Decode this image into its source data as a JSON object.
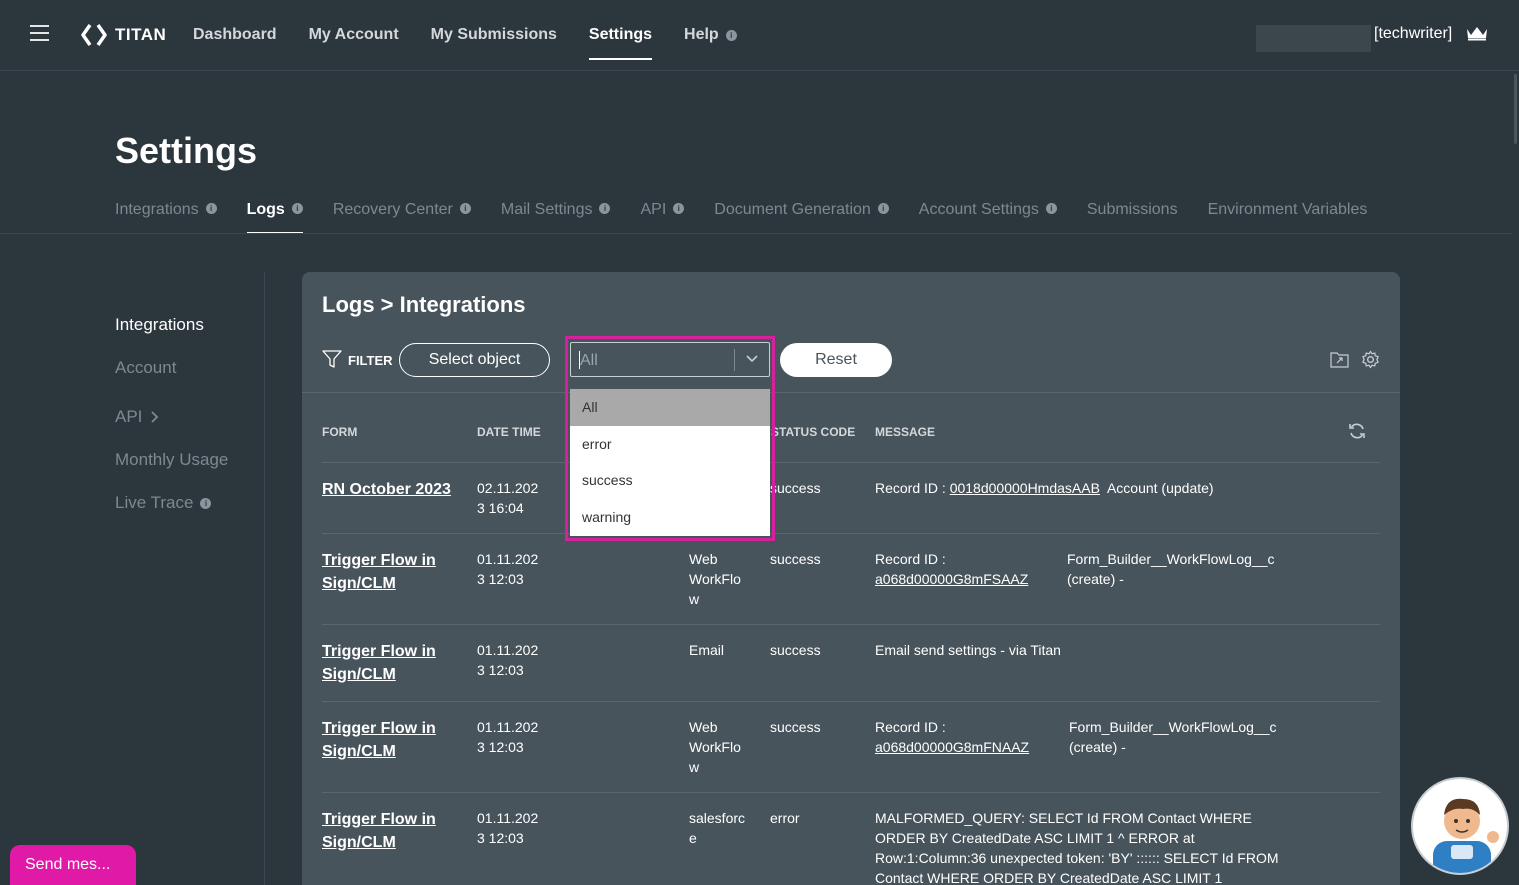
{
  "topbar": {
    "brand": "TITAN",
    "nav": [
      "Dashboard",
      "My Account",
      "My Submissions",
      "Settings",
      "Help"
    ],
    "active_nav": "Settings",
    "user": "[techwriter]"
  },
  "page": {
    "title": "Settings",
    "tabs": [
      "Integrations",
      "Logs",
      "Recovery Center",
      "Mail Settings",
      "API",
      "Document Generation",
      "Account Settings",
      "Submissions",
      "Environment Variables"
    ],
    "active_tab": "Logs"
  },
  "side": {
    "items": [
      "Integrations",
      "Account",
      "API",
      "Monthly Usage",
      "Live Trace"
    ],
    "active": "Integrations"
  },
  "panel": {
    "title": "Logs > Integrations",
    "filter_label": "FILTER",
    "select_object_label": "Select object",
    "status_select_value": "All",
    "reset_label": "Reset",
    "columns": [
      "FORM",
      "DATE TIME",
      "STATUS CODE",
      "MESSAGE"
    ],
    "status_options": [
      "All",
      "error",
      "success",
      "warning"
    ]
  },
  "rows": [
    {
      "form": "RN October 2023",
      "date": "02.11.202",
      "time": "3 16:04",
      "type": "",
      "status": "success",
      "message": "Record ID :",
      "record_id": "0018d00000HmdasAAB",
      "extra": "Account (update)"
    },
    {
      "form_1": "Trigger Flow in",
      "form_2": "Sign/CLM",
      "date": "01.11.202",
      "time": "3 12:03",
      "type_1": "Web",
      "type_2": "WorkFlo",
      "type_3": "w",
      "status": "success",
      "message": "Record ID :",
      "record_id": "a068d00000G8mFSAAZ",
      "extra_1": "Form_Builder__WorkFlowLog__c",
      "extra_2": "(create) -"
    },
    {
      "form_1": "Trigger Flow in",
      "form_2": "Sign/CLM",
      "date": "01.11.202",
      "time": "3 12:03",
      "type_1": "Email",
      "status": "success",
      "message": "Email send settings - via Titan"
    },
    {
      "form_1": "Trigger Flow in",
      "form_2": "Sign/CLM",
      "date": "01.11.202",
      "time": "3 12:03",
      "type_1": "Web",
      "type_2": "WorkFlo",
      "type_3": "w",
      "status": "success",
      "message": "Record ID :",
      "record_id": "a068d00000G8mFNAAZ",
      "extra_1": "Form_Builder__WorkFlowLog__c",
      "extra_2": "(create) -"
    },
    {
      "form_1": "Trigger Flow in",
      "form_2": "Sign/CLM",
      "date": "01.11.202",
      "time": "3 12:03",
      "type_1": "salesforc",
      "type_2": "e",
      "status": "error",
      "msg_1": "MALFORMED_QUERY: SELECT Id FROM Contact WHERE",
      "msg_2": "ORDER BY CreatedDate ASC LIMIT 1 ^ ERROR at",
      "msg_3": "Row:1:Column:36 unexpected token: 'BY' :::::: SELECT Id FROM",
      "msg_4": "Contact WHERE ORDER BY CreatedDate ASC LIMIT 1"
    }
  ],
  "widgets": {
    "send_message": "Send mes..."
  },
  "colors": {
    "background": "#2c363d",
    "panel": "#48545b",
    "highlight": "#d6219c",
    "chat": "#e01aa7"
  }
}
